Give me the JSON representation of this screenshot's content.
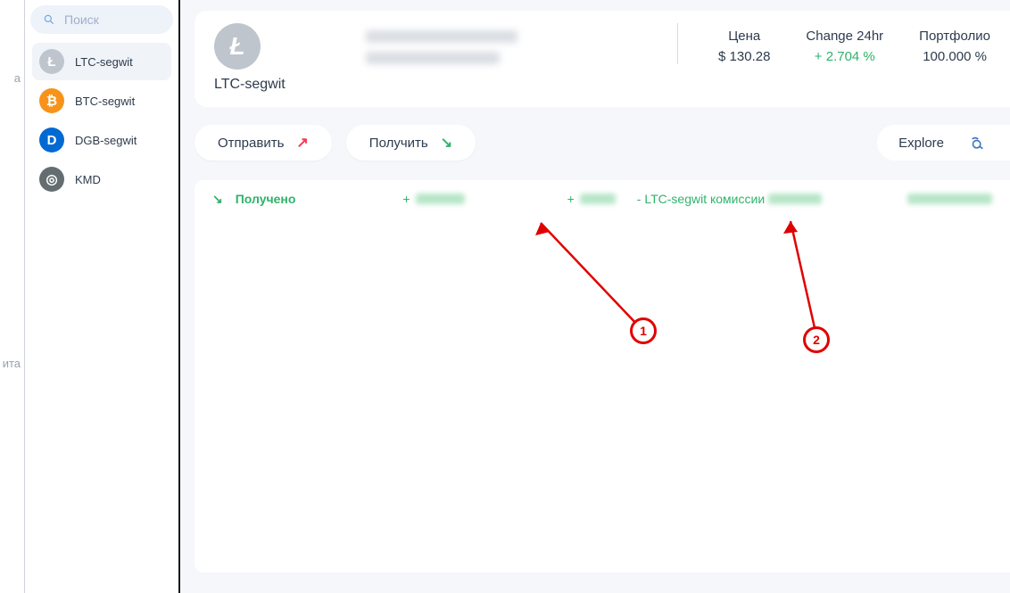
{
  "nav": {
    "label_top": "a",
    "label_mid": "ита"
  },
  "sidebar": {
    "search_placeholder": "Поиск",
    "wallets": [
      {
        "label": "LTC-segwit",
        "glyph": "Ł",
        "icon_class": "ic-ltc",
        "selected": true
      },
      {
        "label": "BTC-segwit",
        "glyph": "₿",
        "icon_class": "ic-btc",
        "selected": false
      },
      {
        "label": "DGB-segwit",
        "glyph": "D",
        "icon_class": "ic-dgb",
        "selected": false
      },
      {
        "label": "KMD",
        "glyph": "◎",
        "icon_class": "ic-kmd",
        "selected": false
      }
    ]
  },
  "header": {
    "coin_glyph": "Ł",
    "coin_title": "LTC-segwit",
    "stats": {
      "price_label": "Цена",
      "price_value": "$ 130.28",
      "change_label": "Change 24hr",
      "change_value": "+ 2.704 %",
      "portfolio_label": "Портфолио",
      "portfolio_value": "100.000 %"
    }
  },
  "actions": {
    "send_label": "Отправить",
    "receive_label": "Получить",
    "explore_label": "Explore"
  },
  "txn": {
    "status_label": "Получено",
    "plus1": "+",
    "plus2": "+",
    "fee_prefix": "- LTC-segwit комиссии"
  },
  "annotations": {
    "n1": "1",
    "n2": "2"
  }
}
